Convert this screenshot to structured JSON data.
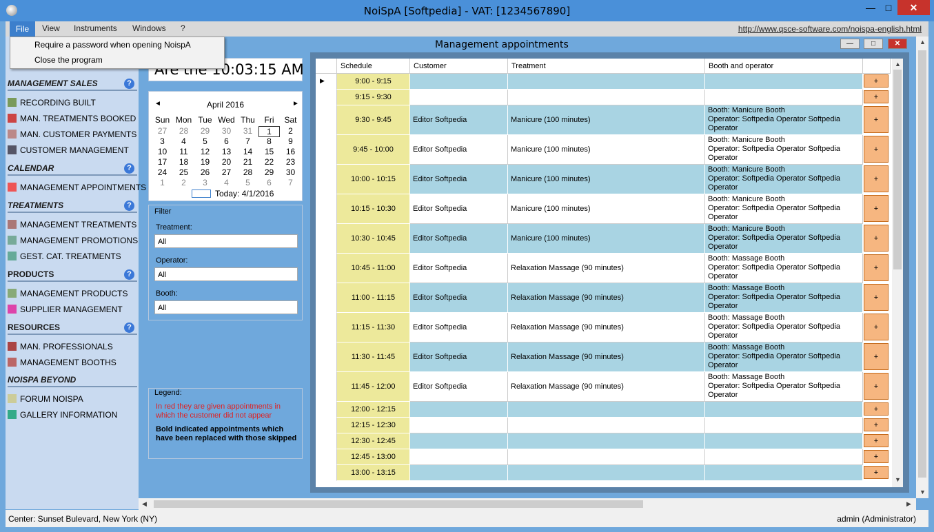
{
  "window": {
    "title": "NoiSpA [Softpedia] - VAT: [1234567890]"
  },
  "menu": {
    "items": [
      "File",
      "View",
      "Instruments",
      "Windows",
      "?"
    ],
    "link": "http://www.qsce-software.com/noispa-english.html"
  },
  "file_menu": [
    "Require a password when opening NoispA",
    "Close the program"
  ],
  "sidebar": {
    "sections": [
      {
        "title": "MANAGEMENT SALES",
        "items": [
          "RECORDING BUILT",
          "MAN. TREATMENTS BOOKED",
          "MAN. CUSTOMER PAYMENTS",
          "CUSTOMER MANAGEMENT"
        ]
      },
      {
        "title": "CALENDAR",
        "items": [
          "MANAGEMENT APPOINTMENTS"
        ]
      },
      {
        "title": "TREATMENTS",
        "items": [
          "MANAGEMENT TREATMENTS",
          "MANAGEMENT PROMOTIONS",
          "GEST. CAT. TREATMENTS"
        ]
      },
      {
        "title": "PRODUCTS",
        "items": [
          "MANAGEMENT PRODUCTS",
          "SUPPLIER MANAGEMENT"
        ]
      },
      {
        "title": "RESOURCES",
        "items": [
          "MAN. PROFESSIONALS",
          "MANAGEMENT BOOTHS"
        ]
      },
      {
        "title": "NOISPA BEYOND",
        "items": [
          "FORUM NOISPA",
          "GALLERY INFORMATION"
        ]
      }
    ],
    "help": "?"
  },
  "clock": "Are the 10:03:15 AM",
  "calendar": {
    "month": "April 2016",
    "prev": "◄",
    "next": "►",
    "dow": [
      "Sun",
      "Mon",
      "Tue",
      "Wed",
      "Thu",
      "Fri",
      "Sat"
    ],
    "weeks": [
      [
        "27",
        "28",
        "29",
        "30",
        "31",
        "1",
        "2"
      ],
      [
        "3",
        "4",
        "5",
        "6",
        "7",
        "8",
        "9"
      ],
      [
        "10",
        "11",
        "12",
        "13",
        "14",
        "15",
        "16"
      ],
      [
        "17",
        "18",
        "19",
        "20",
        "21",
        "22",
        "23"
      ],
      [
        "24",
        "25",
        "26",
        "27",
        "28",
        "29",
        "30"
      ],
      [
        "1",
        "2",
        "3",
        "4",
        "5",
        "6",
        "7"
      ]
    ],
    "today": "Today: 4/1/2016"
  },
  "filter": {
    "title": "Filter",
    "fields": [
      {
        "label": "Treatment:",
        "value": "All"
      },
      {
        "label": "Operator:",
        "value": "All"
      },
      {
        "label": "Booth:",
        "value": "All"
      }
    ]
  },
  "legend": {
    "title": "Legend:",
    "red": "In red they are given appointments in which the customer did not appear",
    "bold": "Bold indicated appointments which have been replaced with those skipped"
  },
  "child_window": {
    "title": "Management appointments"
  },
  "grid": {
    "columns": [
      "Schedule",
      "Customer",
      "Treatment",
      "Booth and operator"
    ],
    "plus": "+",
    "rows": [
      {
        "time": "9:00 - 9:15",
        "customer": "",
        "treatment": "",
        "booth": []
      },
      {
        "time": "9:15 - 9:30",
        "customer": "",
        "treatment": "",
        "booth": []
      },
      {
        "time": "9:30 - 9:45",
        "customer": "Editor Softpedia",
        "treatment": "Manicure (100 minutes)",
        "booth": [
          "Booth: Manicure Booth",
          "Operator: Softpedia Operator Softpedia",
          "Operator"
        ]
      },
      {
        "time": "9:45 - 10:00",
        "customer": "Editor Softpedia",
        "treatment": "Manicure (100 minutes)",
        "booth": [
          "Booth: Manicure Booth",
          "Operator: Softpedia Operator Softpedia",
          "Operator"
        ]
      },
      {
        "time": "10:00 - 10:15",
        "customer": "Editor Softpedia",
        "treatment": "Manicure (100 minutes)",
        "booth": [
          "Booth: Manicure Booth",
          "Operator: Softpedia Operator Softpedia",
          "Operator"
        ]
      },
      {
        "time": "10:15 - 10:30",
        "customer": "Editor Softpedia",
        "treatment": "Manicure (100 minutes)",
        "booth": [
          "Booth: Manicure Booth",
          "Operator: Softpedia Operator Softpedia",
          "Operator"
        ]
      },
      {
        "time": "10:30 - 10:45",
        "customer": "Editor Softpedia",
        "treatment": "Manicure (100 minutes)",
        "booth": [
          "Booth: Manicure Booth",
          "Operator: Softpedia Operator Softpedia",
          "Operator"
        ]
      },
      {
        "time": "10:45 - 11:00",
        "customer": "Editor Softpedia",
        "treatment": "Relaxation Massage (90 minutes)",
        "booth": [
          "Booth: Massage Booth",
          "Operator: Softpedia Operator Softpedia",
          "Operator"
        ]
      },
      {
        "time": "11:00 - 11:15",
        "customer": "Editor Softpedia",
        "treatment": "Relaxation Massage (90 minutes)",
        "booth": [
          "Booth: Massage Booth",
          "Operator: Softpedia Operator Softpedia",
          "Operator"
        ]
      },
      {
        "time": "11:15 - 11:30",
        "customer": "Editor Softpedia",
        "treatment": "Relaxation Massage (90 minutes)",
        "booth": [
          "Booth: Massage Booth",
          "Operator: Softpedia Operator Softpedia",
          "Operator"
        ]
      },
      {
        "time": "11:30 - 11:45",
        "customer": "Editor Softpedia",
        "treatment": "Relaxation Massage (90 minutes)",
        "booth": [
          "Booth: Massage Booth",
          "Operator: Softpedia Operator Softpedia",
          "Operator"
        ]
      },
      {
        "time": "11:45 - 12:00",
        "customer": "Editor Softpedia",
        "treatment": "Relaxation Massage (90 minutes)",
        "booth": [
          "Booth: Massage Booth",
          "Operator: Softpedia Operator Softpedia",
          "Operator"
        ]
      },
      {
        "time": "12:00 - 12:15",
        "customer": "",
        "treatment": "",
        "booth": []
      },
      {
        "time": "12:15 - 12:30",
        "customer": "",
        "treatment": "",
        "booth": []
      },
      {
        "time": "12:30 - 12:45",
        "customer": "",
        "treatment": "",
        "booth": []
      },
      {
        "time": "12:45 - 13:00",
        "customer": "",
        "treatment": "",
        "booth": []
      },
      {
        "time": "13:00 - 13:15",
        "customer": "",
        "treatment": "",
        "booth": []
      }
    ]
  },
  "status": {
    "left": "Center: Sunset Bulevard,  New York (NY)",
    "right": "admin (Administrator)"
  }
}
